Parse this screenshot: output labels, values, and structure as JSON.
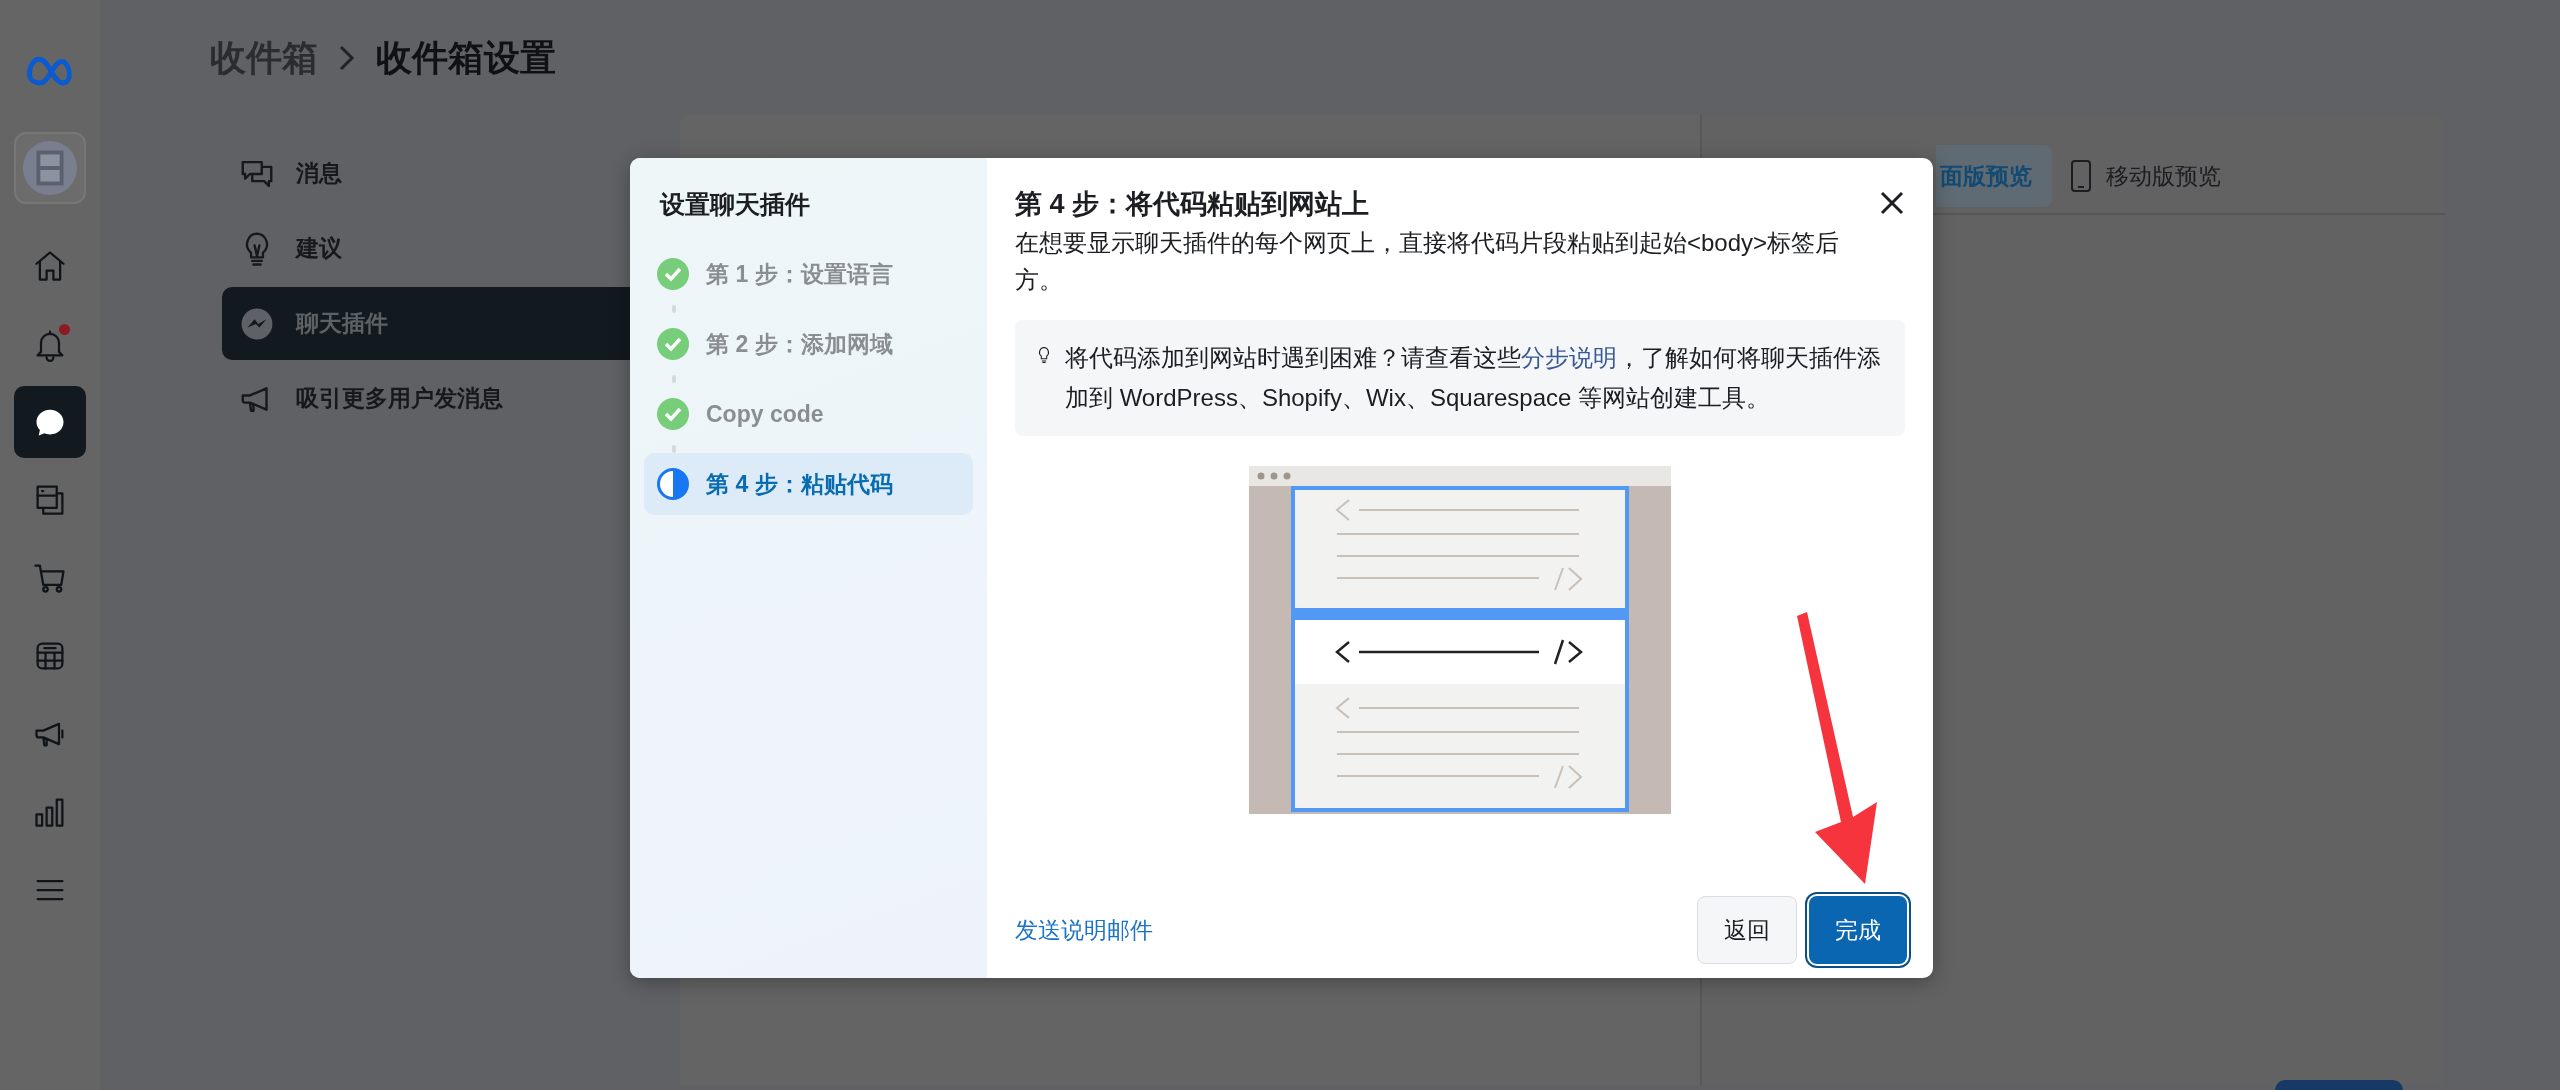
{
  "rail": {
    "items": [
      {
        "kind": "logo",
        "selected": false,
        "badge": false
      },
      {
        "kind": "avatar",
        "selected": false,
        "badge": false
      },
      {
        "kind": "home",
        "selected": false,
        "badge": false
      },
      {
        "kind": "bell",
        "selected": false,
        "badge": true
      },
      {
        "kind": "chat",
        "selected": true,
        "badge": false
      },
      {
        "kind": "pages",
        "selected": false,
        "badge": false
      },
      {
        "kind": "cart",
        "selected": false,
        "badge": false
      },
      {
        "kind": "table",
        "selected": false,
        "badge": false
      },
      {
        "kind": "megaphone",
        "selected": false,
        "badge": false
      },
      {
        "kind": "chart",
        "selected": false,
        "badge": false
      },
      {
        "kind": "menu",
        "selected": false,
        "badge": false
      }
    ]
  },
  "breadcrumb": [
    "收件箱",
    "收件箱设置"
  ],
  "settings_nav": [
    {
      "kind": "messages",
      "label": "消息",
      "selected": false
    },
    {
      "kind": "bulb",
      "label": "建议",
      "selected": false
    },
    {
      "kind": "messenger",
      "label": "聊天插件",
      "selected": true
    },
    {
      "kind": "megaphone",
      "label": "吸引更多用户发消息",
      "selected": false
    }
  ],
  "preview_tabs": [
    {
      "kind": "desktop",
      "label": "面版预览",
      "selected": true
    },
    {
      "kind": "mobile",
      "label": "移动版预览",
      "selected": false
    }
  ],
  "dialog": {
    "title": "设置聊天插件",
    "steps": [
      {
        "label": "第 1 步：设置语言",
        "done": true,
        "selected": false
      },
      {
        "label": "第 2 步：添加网域",
        "done": true,
        "selected": false
      },
      {
        "label": "Copy code",
        "done": true,
        "selected": false
      },
      {
        "label": "第 4 步：粘贴代码",
        "done": false,
        "selected": true
      }
    ],
    "heading": "第 4 步：将代码粘贴到网站上",
    "description": "在想要显示聊天插件的每个网页上，直接将代码片段粘贴到起始<body>标签后方。",
    "tip": {
      "before": "将代码添加到网站时遇到困难？请查看这些",
      "link": "分步说明",
      "after": "，了解如何将聊天插件添加到 WordPress、Shopify、Wix、Squarespace 等网站创建工具。"
    },
    "email_link": "发送说明邮件",
    "buttons": [
      {
        "kind": "secondary",
        "label": "返回",
        "focused": false
      },
      {
        "kind": "primary",
        "label": "完成",
        "focused": true
      }
    ]
  }
}
